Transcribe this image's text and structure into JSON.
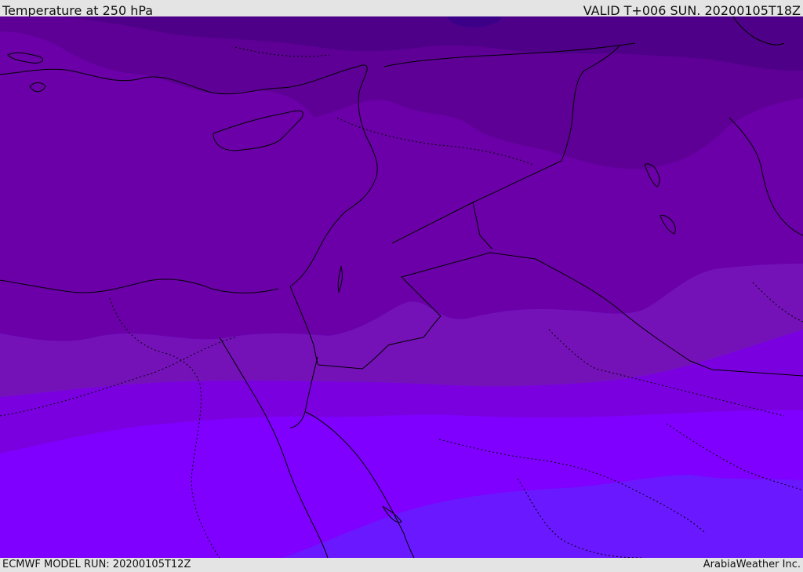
{
  "header": {
    "title": "Temperature at 250 hPa",
    "valid": "VALID T+006 SUN. 20200105T18Z"
  },
  "footer": {
    "model_run": "ECMWF MODEL RUN: 20200105T12Z",
    "credit": "ArabiaWeather Inc."
  },
  "colors": {
    "band_coldest": "#3c0088",
    "band_1": "#4f0088",
    "band_2": "#5e0096",
    "band_3": "#6b00a8",
    "band_4": "#7412b8",
    "band_5": "#7a00e0",
    "band_6": "#7f00ff",
    "band_warmest": "#6a18ff",
    "outline": "#000000"
  }
}
